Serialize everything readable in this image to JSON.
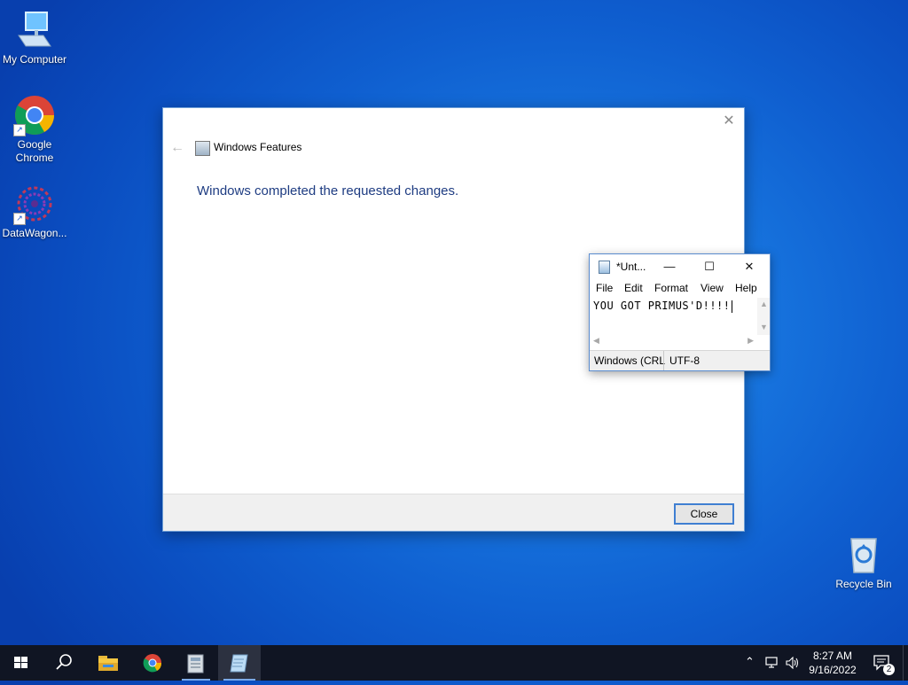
{
  "desktop": {
    "icons": [
      {
        "label": "My Computer"
      },
      {
        "label": "Google Chrome"
      },
      {
        "label": "DataWagon..."
      },
      {
        "label": "Recycle Bin"
      }
    ]
  },
  "dialog": {
    "title": "Windows Features",
    "message": "Windows completed the requested changes.",
    "close_label": "Close",
    "back_icon": "back-arrow-icon",
    "close_icon": "close-icon"
  },
  "notepad": {
    "title": "*Unt...",
    "menu": [
      "File",
      "Edit",
      "Format",
      "View",
      "Help"
    ],
    "content": "YOU GOT PRIMUS'D!!!!",
    "status": {
      "line_ending": "Windows (CRL",
      "encoding": "UTF-8"
    }
  },
  "taskbar": {
    "time": "8:27 AM",
    "date": "9/16/2022",
    "notifications": "2",
    "items": [
      "start-icon",
      "search-icon",
      "file-explorer-icon",
      "chrome-icon",
      "installer-icon",
      "notepad-icon"
    ]
  },
  "colors": {
    "accent": "#3f7fd2",
    "message_text": "#1e3c82",
    "taskbar": "#101523"
  }
}
